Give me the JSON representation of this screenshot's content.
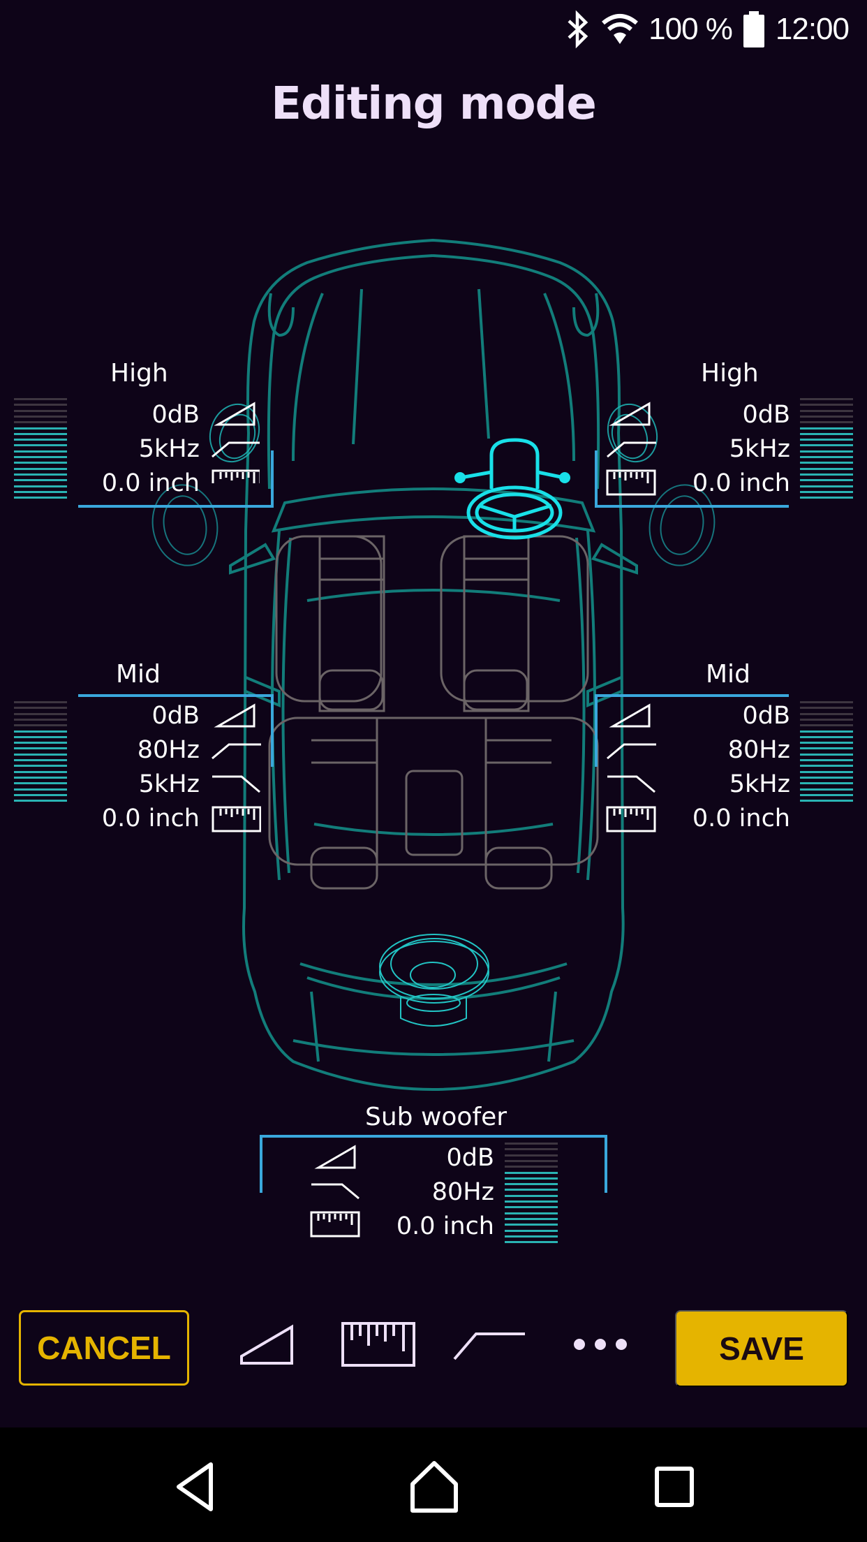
{
  "status_bar": {
    "icons": [
      "bluetooth-icon",
      "wifi-icon",
      "battery-icon"
    ],
    "battery_percent": "100 %",
    "time": "12:00"
  },
  "header": {
    "title": "Editing mode"
  },
  "speakers": {
    "front_left": {
      "label": "High",
      "gain": "0dB",
      "hpf": "5kHz",
      "distance": "0.0 inch",
      "meter_level": 13,
      "meter_segments": 18
    },
    "front_right": {
      "label": "High",
      "gain": "0dB",
      "hpf": "5kHz",
      "distance": "0.0 inch",
      "meter_level": 13,
      "meter_segments": 18
    },
    "mid_left": {
      "label": "Mid",
      "gain": "0dB",
      "hpf": "80Hz",
      "lpf": "5kHz",
      "distance": "0.0 inch",
      "meter_level": 13,
      "meter_segments": 18
    },
    "mid_right": {
      "label": "Mid",
      "gain": "0dB",
      "hpf": "80Hz",
      "lpf": "5kHz",
      "distance": "0.0 inch",
      "meter_level": 13,
      "meter_segments": 18
    },
    "subwoofer": {
      "label": "Sub woofer",
      "gain": "0dB",
      "lpf": "80Hz",
      "distance": "0.0 inch",
      "meter_level": 13,
      "meter_segments": 18
    }
  },
  "toolbar": {
    "cancel_label": "CANCEL",
    "save_label": "SAVE",
    "tools": [
      "gain-icon",
      "distance-ruler-icon",
      "crossover-filter-icon",
      "more-icon"
    ]
  },
  "colors": {
    "background": "#0e0418",
    "accent_yellow": "#e5b400",
    "car_outline": "#127d7a",
    "bracket_blue": "#3aa8dc",
    "highlight_cyan": "#19e0e8",
    "meter_lit": "#2ab3b3",
    "meter_dim": "#3d3540"
  },
  "nav_bar": {
    "buttons": [
      "back-icon",
      "home-icon",
      "recents-icon"
    ]
  }
}
